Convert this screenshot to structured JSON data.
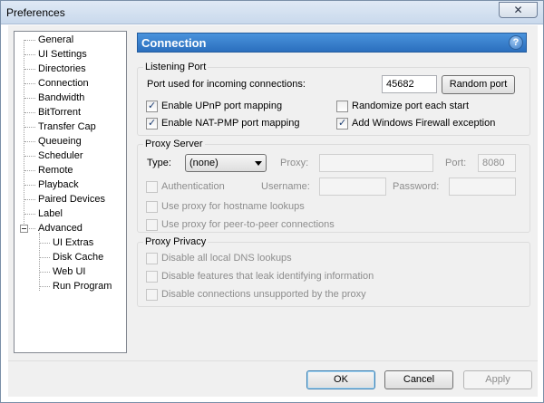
{
  "window": {
    "title": "Preferences",
    "close_glyph": "✕"
  },
  "sidebar": {
    "items": [
      {
        "label": "General"
      },
      {
        "label": "UI Settings"
      },
      {
        "label": "Directories"
      },
      {
        "label": "Connection"
      },
      {
        "label": "Bandwidth"
      },
      {
        "label": "BitTorrent"
      },
      {
        "label": "Transfer Cap"
      },
      {
        "label": "Queueing"
      },
      {
        "label": "Scheduler"
      },
      {
        "label": "Remote"
      },
      {
        "label": "Playback"
      },
      {
        "label": "Paired Devices"
      },
      {
        "label": "Label"
      },
      {
        "label": "Advanced"
      }
    ],
    "subitems": [
      {
        "label": "UI Extras"
      },
      {
        "label": "Disk Cache"
      },
      {
        "label": "Web UI"
      },
      {
        "label": "Run Program"
      }
    ]
  },
  "header": {
    "title": "Connection",
    "help_glyph": "?"
  },
  "listening_port": {
    "title": "Listening Port",
    "port_label": "Port used for incoming connections:",
    "port_value": "45682",
    "random_port_button": "Random port",
    "upnp_label": "Enable UPnP port mapping",
    "upnp_checked": true,
    "randomize_label": "Randomize port each start",
    "randomize_checked": false,
    "natpmp_label": "Enable NAT-PMP port mapping",
    "natpmp_checked": true,
    "firewall_label": "Add Windows Firewall exception",
    "firewall_checked": true
  },
  "proxy_server": {
    "title": "Proxy Server",
    "type_label": "Type:",
    "type_value": "(none)",
    "proxy_label": "Proxy:",
    "proxy_value": "",
    "port_label": "Port:",
    "port_value": "8080",
    "auth_label": "Authentication",
    "username_label": "Username:",
    "username_value": "",
    "password_label": "Password:",
    "password_value": "",
    "hostname_lookup_label": "Use proxy for hostname lookups",
    "p2p_label": "Use proxy for peer-to-peer connections"
  },
  "proxy_privacy": {
    "title": "Proxy Privacy",
    "dns_label": "Disable all local DNS lookups",
    "leak_label": "Disable features that leak identifying information",
    "unsupported_label": "Disable connections unsupported by the proxy"
  },
  "footer": {
    "ok": "OK",
    "cancel": "Cancel",
    "apply": "Apply"
  }
}
